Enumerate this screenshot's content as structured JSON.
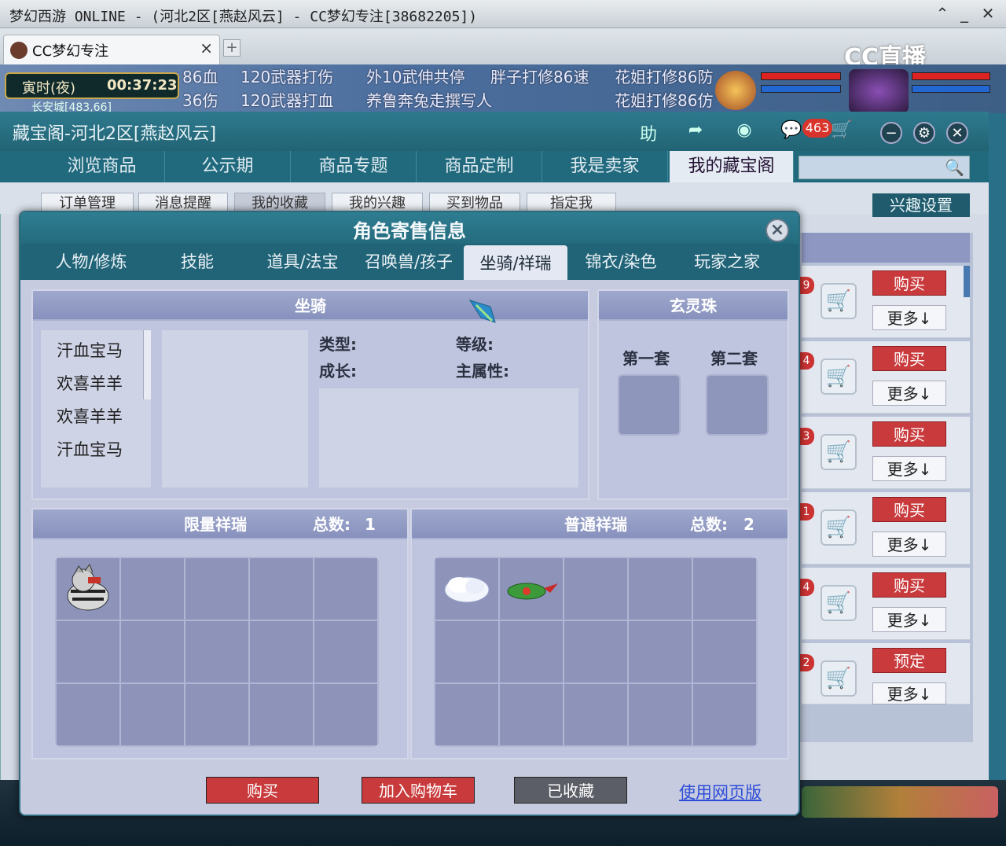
{
  "window": {
    "title": "梦幻西游 ONLINE - (河北2区[燕赵风云] - CC梦幻专注[38682205])"
  },
  "browser": {
    "tab_label": "CC梦幻专注",
    "tab_close": "×",
    "new_tab": "+",
    "logo_text": "CC直播"
  },
  "game": {
    "time_period": "寅时(夜)",
    "time": "00:37:23",
    "location": "长安城[483,66]",
    "strip_top": [
      "86血",
      "120武器打伤",
      "外10武伸共停",
      "胖子打修86速",
      "花姐打修86防"
    ],
    "strip_bottom": [
      "36伤",
      "120武器打血",
      "养鲁奔兔走撰写人",
      "花姐打修86仿"
    ]
  },
  "outer": {
    "title": "藏宝阁-河北2区[燕赵风云]",
    "help": "助",
    "cart_count": "463",
    "nav": [
      "浏览商品",
      "公示期",
      "商品专题",
      "商品定制",
      "我是卖家",
      "我的藏宝阁"
    ],
    "nav_active": 5,
    "subtabs": [
      "订单管理",
      "消息提醒",
      "我的收藏",
      "我的兴趣",
      "买到物品",
      "指定我"
    ],
    "interest_button": "兴趣设置",
    "right_rows": [
      {
        "num": "9",
        "action": "购买",
        "more": "更多↓"
      },
      {
        "num": "4",
        "action": "购买",
        "more": "更多↓"
      },
      {
        "num": "3",
        "action": "购买",
        "more": "更多↓"
      },
      {
        "num": "1",
        "action": "购买",
        "more": "更多↓"
      },
      {
        "num": "4",
        "action": "购买",
        "more": "更多↓"
      },
      {
        "num": "2",
        "action": "预定",
        "more": "更多↓"
      }
    ]
  },
  "modal": {
    "title": "角色寄售信息",
    "close": "×",
    "tabs": [
      "人物/修炼",
      "技能",
      "道具/法宝",
      "召唤兽/孩子",
      "坐骑/祥瑞",
      "锦衣/染色",
      "玩家之家"
    ],
    "active_tab": 4,
    "mount": {
      "header": "坐骑",
      "list": [
        "汗血宝马",
        "欢喜羊羊",
        "欢喜羊羊",
        "汗血宝马"
      ],
      "type_label": "类型:",
      "level_label": "等级:",
      "growth_label": "成长:",
      "attr_label": "主属性:"
    },
    "pearl": {
      "header": "玄灵珠",
      "set1": "第一套",
      "set2": "第二套"
    },
    "limited": {
      "header": "限量祥瑞",
      "total_label": "总数:",
      "total": "1"
    },
    "normal": {
      "header": "普通祥瑞",
      "total_label": "总数:",
      "total": "2"
    },
    "buttons": {
      "buy": "购买",
      "add_cart": "加入购物车",
      "favorited": "已收藏",
      "web_version": "使用网页版"
    }
  },
  "colors": {
    "accent_teal": "#216478",
    "buy_red": "#c93a3c",
    "panel_lavender": "#bfc5de",
    "link_blue": "#2b4cd6"
  },
  "icons": [
    "cart-icon",
    "search-icon",
    "close-icon",
    "gear-icon",
    "minus-icon",
    "share-icon",
    "chat-icon",
    "cat-mount-icon",
    "cloud-icon",
    "dragon-icon",
    "feather-icon"
  ]
}
